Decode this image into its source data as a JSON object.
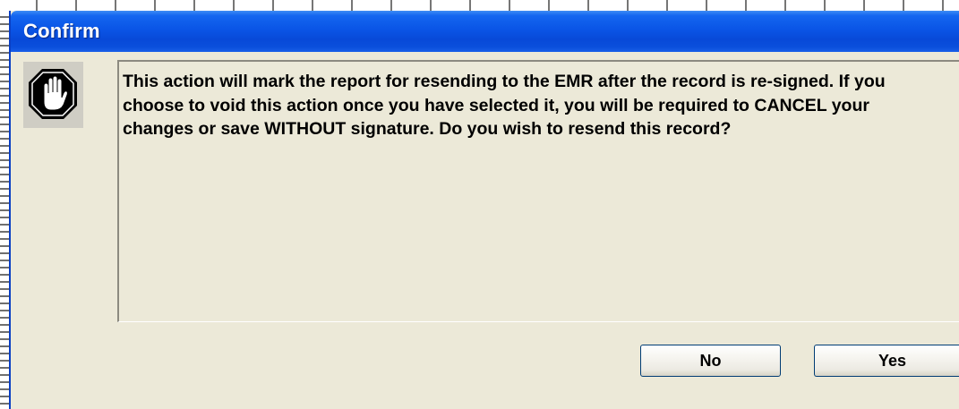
{
  "dialog": {
    "title": "Confirm",
    "icon": "stop-hand-icon",
    "message": "This action will mark the report for resending to the EMR after the record is re-signed.  If you\nchoose to void this action once you have selected it, you will be required to CANCEL your\nchanges or save WITHOUT signature.  Do you wish to resend this record?",
    "buttons": {
      "no_label": "No",
      "yes_label": "Yes"
    }
  },
  "colors": {
    "titlebar": "#0a55e6",
    "dialog_bg": "#ece9d8",
    "title_text": "#ffffff"
  }
}
